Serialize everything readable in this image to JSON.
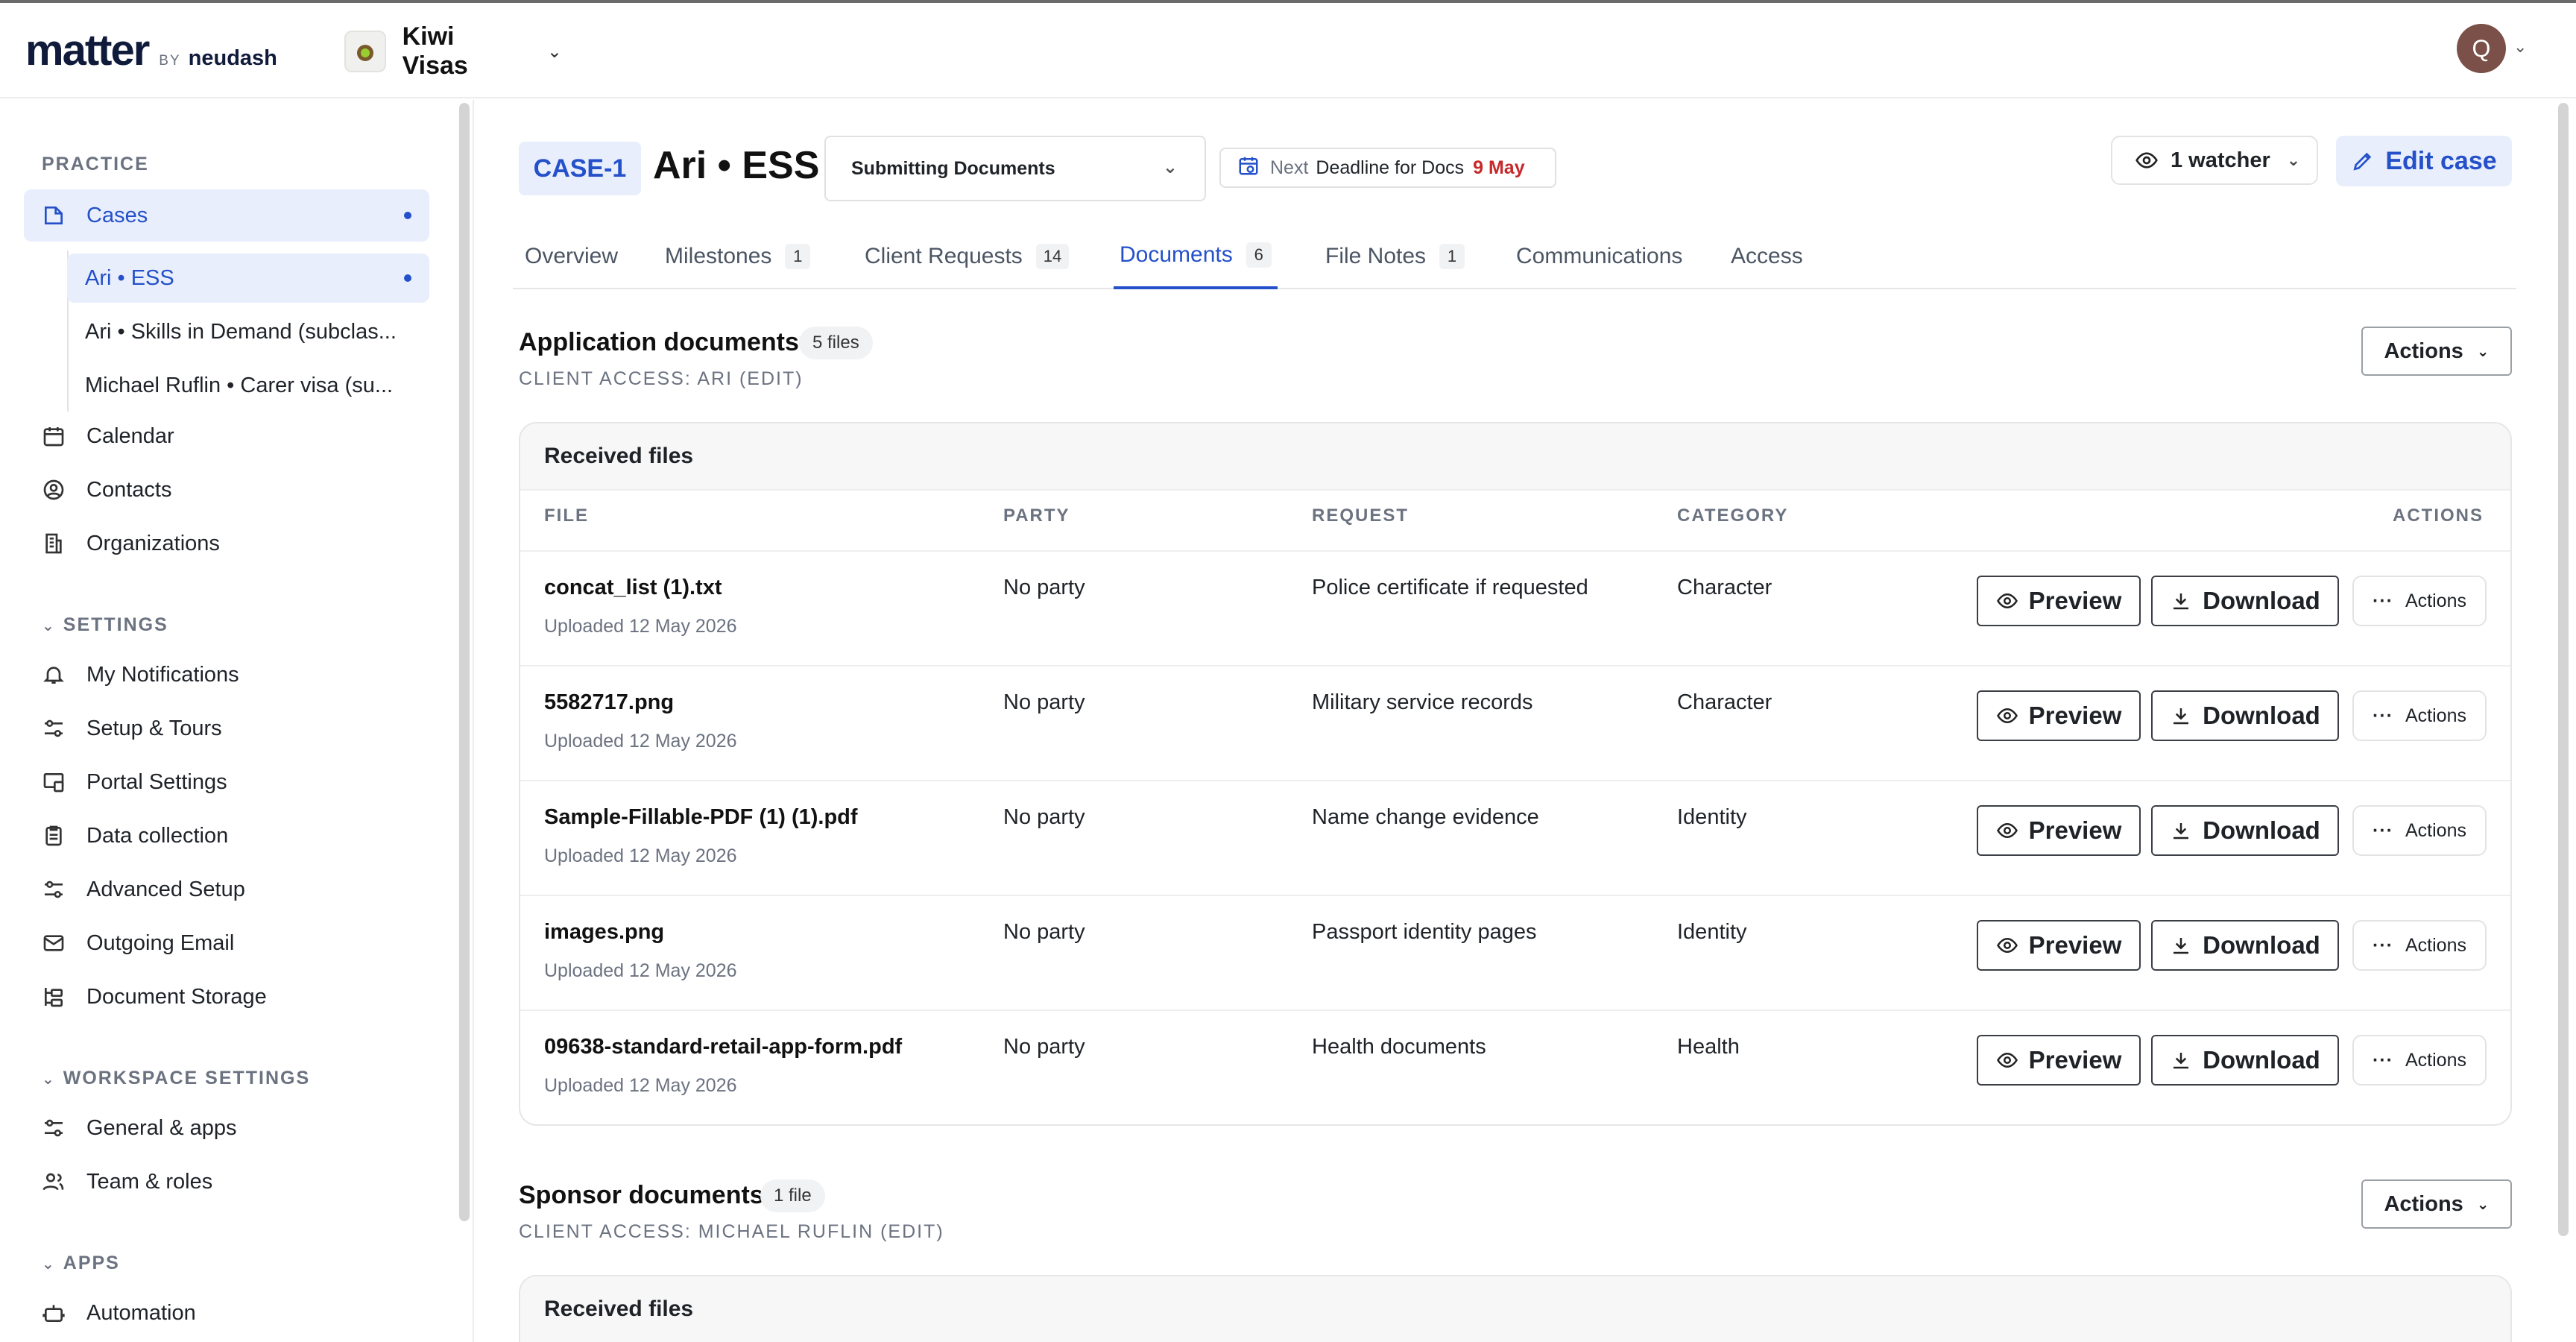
{
  "header": {
    "logo_main": "matter",
    "logo_by": "BY",
    "logo_brand": "neudash",
    "workspace_name": "Kiwi Visas",
    "avatar_initial": "Q"
  },
  "sidebar": {
    "practice_label": "PRACTICE",
    "cases": {
      "label": "Cases"
    },
    "case_items": [
      {
        "label": "Ari • ESS"
      },
      {
        "label": "Ari • Skills in Demand (subclas..."
      },
      {
        "label": "Michael Ruflin • Carer visa (su..."
      }
    ],
    "practice_items": [
      {
        "label": "Calendar",
        "icon": "calendar-icon"
      },
      {
        "label": "Contacts",
        "icon": "contacts-icon"
      },
      {
        "label": "Organizations",
        "icon": "organizations-icon"
      }
    ],
    "settings_label": "SETTINGS",
    "settings_items": [
      {
        "label": "My Notifications",
        "icon": "bell-icon"
      },
      {
        "label": "Setup & Tours",
        "icon": "sliders-icon"
      },
      {
        "label": "Portal Settings",
        "icon": "portal-icon"
      },
      {
        "label": "Data collection",
        "icon": "clipboard-icon"
      },
      {
        "label": "Advanced Setup",
        "icon": "sliders-icon"
      },
      {
        "label": "Outgoing Email",
        "icon": "mail-icon"
      },
      {
        "label": "Document Storage",
        "icon": "storage-icon"
      }
    ],
    "workspace_settings_label": "WORKSPACE SETTINGS",
    "workspace_items": [
      {
        "label": "General & apps",
        "icon": "sliders-icon"
      },
      {
        "label": "Team & roles",
        "icon": "team-icon"
      }
    ],
    "apps_label": "APPS",
    "apps_items": [
      {
        "label": "Automation",
        "icon": "robot-icon"
      }
    ]
  },
  "case": {
    "id": "CASE-1",
    "title": "Ari • ESS",
    "stage": "Submitting Documents",
    "deadline_label": "Next",
    "deadline_text": "Deadline for Docs",
    "deadline_date": "9 May",
    "watchers": "1 watcher",
    "edit_label": "Edit case"
  },
  "tabs": [
    {
      "label": "Overview",
      "count": ""
    },
    {
      "label": "Milestones",
      "count": "1"
    },
    {
      "label": "Client Requests",
      "count": "14"
    },
    {
      "label": "Documents",
      "count": "6"
    },
    {
      "label": "File Notes",
      "count": "1"
    },
    {
      "label": "Communications",
      "count": ""
    },
    {
      "label": "Access",
      "count": ""
    }
  ],
  "application_docs": {
    "title": "Application documents",
    "badge": "5 files",
    "access": "CLIENT ACCESS: ARI (EDIT)",
    "actions_label": "Actions",
    "card_title": "Received files",
    "columns": {
      "file": "FILE",
      "party": "PARTY",
      "request": "REQUEST",
      "category": "CATEGORY",
      "actions": "ACTIONS"
    },
    "rows": [
      {
        "file": "concat_list (1).txt",
        "uploaded": "Uploaded 12 May 2026",
        "party": "No party",
        "request": "Police certificate if requested",
        "category": "Character"
      },
      {
        "file": "5582717.png",
        "uploaded": "Uploaded 12 May 2026",
        "party": "No party",
        "request": "Military service records",
        "category": "Character"
      },
      {
        "file": "Sample-Fillable-PDF (1) (1).pdf",
        "uploaded": "Uploaded 12 May 2026",
        "party": "No party",
        "request": "Name change evidence",
        "category": "Identity"
      },
      {
        "file": "images.png",
        "uploaded": "Uploaded 12 May 2026",
        "party": "No party",
        "request": "Passport identity pages",
        "category": "Identity"
      },
      {
        "file": "09638-standard-retail-app-form.pdf",
        "uploaded": "Uploaded 12 May 2026",
        "party": "No party",
        "request": "Health documents",
        "category": "Health"
      }
    ],
    "preview_label": "Preview",
    "download_label": "Download",
    "row_actions_label": "Actions"
  },
  "sponsor_docs": {
    "title": "Sponsor documents",
    "badge": "1 file",
    "access": "CLIENT ACCESS: MICHAEL RUFLIN (EDIT)",
    "actions_label": "Actions",
    "card_title": "Received files"
  }
}
